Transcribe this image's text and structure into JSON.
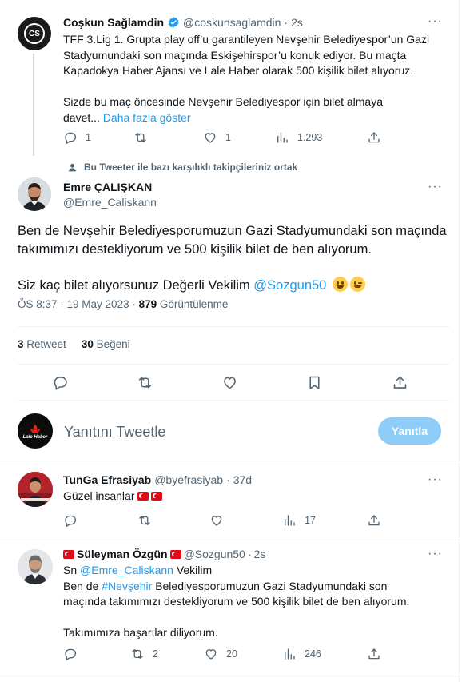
{
  "parent_tweet": {
    "author_name": "Coşkun Sağlamdin",
    "handle": "@coskunsaglamdin",
    "time": "2s",
    "avatar_initials": "CS",
    "text_line1": "TFF 3.Lig 1. Grupta play off’u garantileyen Nevşehir Belediyespor’un Gazi",
    "text_line2": "Stadyumundaki son maçında Eskişehirspor’u konuk ediyor. Bu maçta",
    "text_line3": "Kapadokya Haber Ajansı ve Lale Haber olarak 500 kişilik bilet alıyoruz.",
    "text_line4": "Sizde bu maç öncesinde Nevşehir Belediyespor için bilet almaya",
    "text_line5": "davet...",
    "show_more": "Daha fazla göster",
    "replies": "1",
    "likes": "1",
    "views": "1.293"
  },
  "context": {
    "text": "Bu Tweeter ile bazı karşılıklı takipçileriniz ortak"
  },
  "main_tweet": {
    "author_name": "Emre ÇALIŞKAN",
    "handle": "@Emre_Caliskann",
    "text_line1": "Ben de Nevşehir Belediyesporumuzun Gazi Stadyumundaki son maçında",
    "text_line2": "takımımızı destekliyorum ve 500 kişilik bilet de ben alıyorum.",
    "text_line3_prefix": "Siz kaç bilet alıyorsunuz Değerli Vekilim",
    "mention": "@Sozgun50",
    "timestamp": "ÖS 8:37 · 19 May 2023 ·",
    "views_count": "879",
    "views_label": "Görüntülenme",
    "retweets_count": "3",
    "retweets_label": "Retweet",
    "likes_count": "30",
    "likes_label": "Beğeni"
  },
  "reply_box": {
    "placeholder": "Yanıtını Tweetle",
    "button_label": "Yanıtla",
    "avatar_text": "Lale Haber"
  },
  "replies": [
    {
      "author_name": "TunGa Efrasiyab",
      "handle": "@byefrasiyab",
      "time": "37d",
      "text": "Güzel insanlar",
      "views": "17"
    },
    {
      "author_name": "Süleyman Özgün",
      "handle": "@Sozgun50",
      "time": "2s",
      "reply_prefix": "Sn",
      "reply_mention": "@Emre_Caliskann",
      "reply_suffix": "Vekilim",
      "text_prefix": "Ben de",
      "hashtag": "#Nevşehir",
      "text_rest": "Belediyesporumuzun Gazi Stadyumundaki son",
      "text_line2": "maçında takımımızı destekliyorum ve 500 kişilik bilet de ben alıyorum.",
      "text_line3": "Takımımıza başarılar diliyorum.",
      "retweets": "2",
      "likes": "20",
      "views": "246"
    }
  ],
  "colors": {
    "accent": "#1d9bf0",
    "button_disabled": "#8ecdf8",
    "muted": "#536471",
    "verified": "#1d9bf0"
  },
  "icons": [
    "more-icon",
    "reply-icon",
    "retweet-icon",
    "like-icon",
    "views-icon",
    "share-icon",
    "bookmark-icon",
    "verified-icon",
    "person-icon",
    "flag-icon"
  ]
}
